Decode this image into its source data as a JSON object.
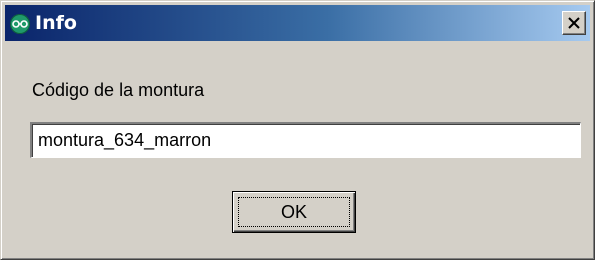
{
  "window": {
    "title": "Info",
    "icon": "glasses-icon",
    "close_icon": "close-icon"
  },
  "form": {
    "label": "Código de la montura",
    "input_value": "montura_634_marron"
  },
  "actions": {
    "ok_label": "OK"
  },
  "colors": {
    "title_gradient_start": "#0a246a",
    "title_gradient_end": "#a6caf0",
    "dialog_background": "#d4d0c8",
    "icon_green": "#1f9a6a"
  }
}
